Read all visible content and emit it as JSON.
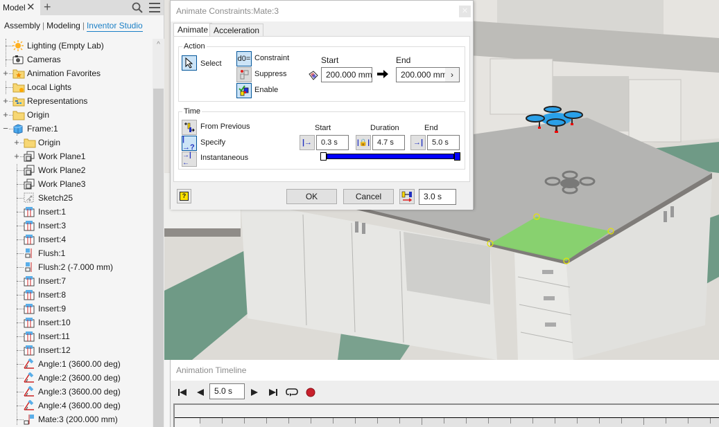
{
  "browser": {
    "tabs": [
      {
        "label": "Model",
        "icon": "close-icon"
      }
    ],
    "add_tab_icon": "plus-icon",
    "search_icon": "search-icon",
    "menu_icon": "hamburger-icon",
    "modes": [
      {
        "label": "Assembly",
        "active": false
      },
      {
        "label": "Modeling",
        "active": false
      },
      {
        "label": "Inventor Studio",
        "active": true
      }
    ],
    "tree": [
      {
        "label": "Lighting (Empty Lab)",
        "icon": "lighting-icon",
        "level": 0,
        "expander": ""
      },
      {
        "label": "Cameras",
        "icon": "camera-icon",
        "level": 0,
        "expander": ""
      },
      {
        "label": "Animation Favorites",
        "icon": "favorites-folder-icon",
        "level": 0,
        "expander": "+"
      },
      {
        "label": "Local Lights",
        "icon": "local-lights-folder-icon",
        "level": 0,
        "expander": ""
      },
      {
        "label": "Representations",
        "icon": "representations-folder-icon",
        "level": 0,
        "expander": "+"
      },
      {
        "label": "Origin",
        "icon": "folder-icon",
        "level": 0,
        "expander": "+"
      },
      {
        "label": "Frame:1",
        "icon": "part-icon",
        "level": 0,
        "expander": "−"
      },
      {
        "label": "Origin",
        "icon": "folder-icon",
        "level": 1,
        "expander": "+"
      },
      {
        "label": "Work Plane1",
        "icon": "work-plane-icon",
        "level": 1,
        "expander": "+"
      },
      {
        "label": "Work Plane2",
        "icon": "work-plane-icon",
        "level": 1,
        "expander": ""
      },
      {
        "label": "Work Plane3",
        "icon": "work-plane-icon",
        "level": 1,
        "expander": ""
      },
      {
        "label": "Sketch25",
        "icon": "sketch-icon",
        "level": 1,
        "expander": ""
      },
      {
        "label": "Insert:1",
        "icon": "insert-constraint-icon",
        "level": 1,
        "expander": ""
      },
      {
        "label": "Insert:3",
        "icon": "insert-constraint-icon",
        "level": 1,
        "expander": ""
      },
      {
        "label": "Insert:4",
        "icon": "insert-constraint-icon",
        "level": 1,
        "expander": ""
      },
      {
        "label": "Flush:1",
        "icon": "flush-constraint-icon",
        "level": 1,
        "expander": ""
      },
      {
        "label": "Flush:2 (-7.000 mm)",
        "icon": "flush-constraint-icon",
        "level": 1,
        "expander": ""
      },
      {
        "label": "Insert:7",
        "icon": "insert-constraint-icon",
        "level": 1,
        "expander": ""
      },
      {
        "label": "Insert:8",
        "icon": "insert-constraint-icon",
        "level": 1,
        "expander": ""
      },
      {
        "label": "Insert:9",
        "icon": "insert-constraint-icon",
        "level": 1,
        "expander": ""
      },
      {
        "label": "Insert:10",
        "icon": "insert-constraint-icon",
        "level": 1,
        "expander": ""
      },
      {
        "label": "Insert:11",
        "icon": "insert-constraint-icon",
        "level": 1,
        "expander": ""
      },
      {
        "label": "Insert:12",
        "icon": "insert-constraint-icon",
        "level": 1,
        "expander": ""
      },
      {
        "label": "Angle:1 (3600.00 deg)",
        "icon": "angle-constraint-icon",
        "level": 1,
        "expander": ""
      },
      {
        "label": "Angle:2 (3600.00 deg)",
        "icon": "angle-constraint-icon",
        "level": 1,
        "expander": ""
      },
      {
        "label": "Angle:3 (3600.00 deg)",
        "icon": "angle-constraint-icon",
        "level": 1,
        "expander": ""
      },
      {
        "label": "Angle:4 (3600.00 deg)",
        "icon": "angle-constraint-icon",
        "level": 1,
        "expander": ""
      },
      {
        "label": "Mate:3 (200.000 mm)",
        "icon": "mate-constraint-icon",
        "level": 1,
        "expander": ""
      }
    ]
  },
  "dialog": {
    "title": "Animate Constraints:Mate:3",
    "close_icon": "close-icon",
    "tabs": [
      {
        "label": "Animate",
        "active": true
      },
      {
        "label": "Acceleration",
        "active": false
      }
    ],
    "action": {
      "legend": "Action",
      "select_label": "Select",
      "options": [
        {
          "label": "Constraint",
          "icon": "constraint-d0-icon",
          "active": true
        },
        {
          "label": "Suppress",
          "icon": "suppress-icon",
          "active": false
        },
        {
          "label": "Enable",
          "icon": "enable-icon",
          "active": true
        }
      ],
      "start_label": "Start",
      "end_label": "End",
      "start_value": "200.000 mm",
      "end_value": "200.000 mm",
      "more_icon": "chevron-right-icon"
    },
    "time": {
      "legend": "Time",
      "modes": [
        {
          "label": "From Previous",
          "icon": "from-previous-icon",
          "active": false
        },
        {
          "label": "Specify",
          "icon": "specify-icon",
          "active": true
        },
        {
          "label": "Instantaneous",
          "icon": "instantaneous-icon",
          "active": false
        }
      ],
      "start_label": "Start",
      "duration_label": "Duration",
      "end_label": "End",
      "start_value": "0.3 s",
      "duration_value": "4.7 s",
      "end_value": "5.0 s",
      "range_start_fraction": 0.06,
      "range_end_fraction": 1.0
    },
    "help_icon": "help-icon",
    "ok_label": "OK",
    "cancel_label": "Cancel",
    "time_slider_value": "3.0 s"
  },
  "timeline": {
    "title": "Animation Timeline",
    "current_time": "5.0 s",
    "controls": [
      "go-to-start-icon",
      "play-reverse-icon",
      "play-forward-icon",
      "go-to-end-icon",
      "repeat-icon",
      "record-icon"
    ],
    "record_color": "#c8202c"
  },
  "colors": {
    "accent": "#1a7fc6",
    "slider_fill": "#0000ff",
    "selection_green": "#86d36b"
  }
}
